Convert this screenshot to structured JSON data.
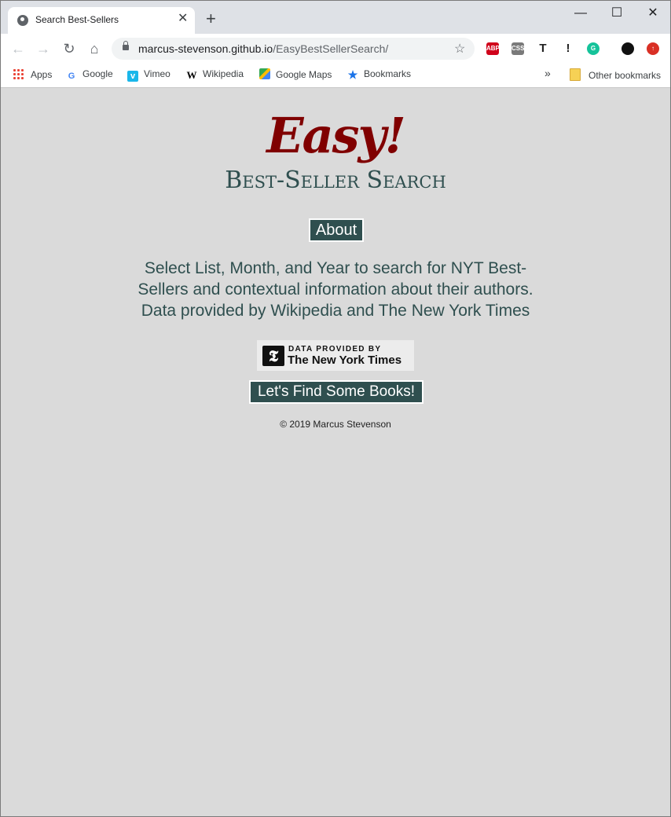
{
  "browser": {
    "tab_title": "Search Best-Sellers",
    "tab_close": "✕",
    "new_tab": "+",
    "window_controls": {
      "minimize": "—",
      "maximize": "☐",
      "close": "✕"
    },
    "url_host": "marcus-stevenson.github.io",
    "url_path": "/EasyBestSellerSearch/",
    "extensions": [
      {
        "name": "adblock-plus-icon",
        "label": "ABP",
        "color": "#d0021b"
      },
      {
        "name": "extension-css-icon",
        "label": "CSS",
        "color": "#7a7a7a"
      },
      {
        "name": "extension-t-icon",
        "label": "T",
        "color": "#222222"
      },
      {
        "name": "extension-exclamation-icon",
        "label": "!",
        "color": "#222222"
      },
      {
        "name": "grammarly-icon",
        "label": "G",
        "color": "#15c39a"
      },
      {
        "name": "profile-avatar-icon",
        "label": "",
        "color": "#111111"
      },
      {
        "name": "update-icon",
        "label": "↑",
        "color": "#d93025"
      }
    ],
    "bookmarks": {
      "apps": "Apps",
      "google": "Google",
      "vimeo": "Vimeo",
      "wikipedia": "Wikipedia",
      "google_maps": "Google Maps",
      "bookmarks": "Bookmarks",
      "overflow": "»",
      "other": "Other bookmarks"
    }
  },
  "page": {
    "logo": "Easy!",
    "subtitle": "Best-Seller Search",
    "about_button": "About",
    "description_line1": "Select List, Month, and Year to search for NYT Best-",
    "description_line2": "Sellers and contextual information about their authors.",
    "description_line3": "Data provided by Wikipedia and The New York Times",
    "nyt_badge_small": "DATA PROVIDED BY",
    "nyt_badge_big": "The New York Times",
    "nyt_logo_glyph": "𝕿",
    "find_button": "Let's Find Some Books!",
    "copyright": "© 2019 Marcus Stevenson"
  },
  "colors": {
    "brand_red": "#800000",
    "slate": "#2f4f4f",
    "background": "#dadada"
  }
}
